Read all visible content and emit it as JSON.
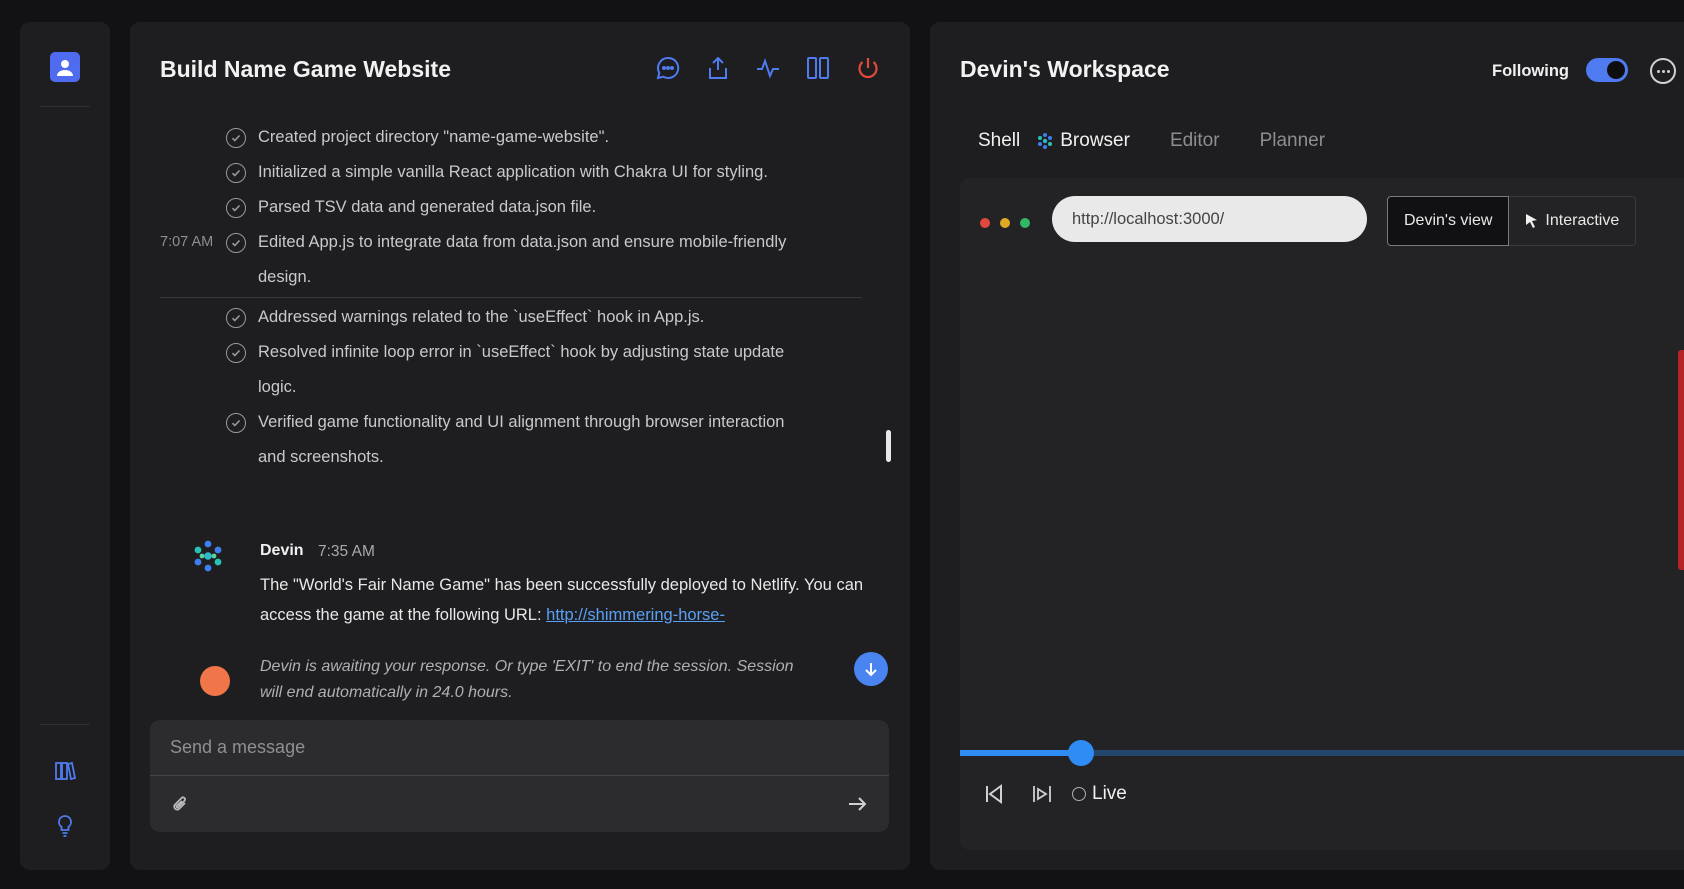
{
  "chat": {
    "title": "Build Name Game Website",
    "tools": [
      "chat-icon",
      "share-icon",
      "activity-icon",
      "columns-icon",
      "power-icon"
    ],
    "steps_a": [
      {
        "text": "Created project directory \"name-game-website\".",
        "time": ""
      },
      {
        "text": "Initialized a simple vanilla React application with Chakra UI for styling.",
        "time": ""
      },
      {
        "text": "Parsed TSV data and generated data.json file.",
        "time": ""
      },
      {
        "text": "Edited App.js to integrate data from data.json and ensure mobile-friendly design.",
        "time": "7:07 AM"
      }
    ],
    "steps_b": [
      {
        "text": "Addressed warnings related to the `useEffect` hook in App.js."
      },
      {
        "text": "Resolved infinite loop error in `useEffect` hook by adjusting state update logic."
      },
      {
        "text": "Verified game functionality and UI alignment through browser interaction and screenshots."
      }
    ],
    "message": {
      "sender": "Devin",
      "time": "7:35 AM",
      "body": "The \"World's Fair Name Game\" has been successfully deployed to Netlify. You can access the game at the following URL: ",
      "link": "http://shimmering-horse-"
    },
    "awaiting": "Devin is awaiting your response. Or type 'EXIT' to end the session. Session will end automatically in 24.0 hours.",
    "composer_placeholder": "Send a message"
  },
  "workspace": {
    "title": "Devin's Workspace",
    "following_label": "Following",
    "following_on": true,
    "tabs": [
      {
        "label": "Shell",
        "active": true
      },
      {
        "label": "Browser",
        "active": true
      },
      {
        "label": "Editor",
        "active": false
      },
      {
        "label": "Planner",
        "active": false
      }
    ],
    "browser": {
      "url": "http://localhost:3000/",
      "view_on": "Devin's view",
      "view_off": "Interactive"
    },
    "timeline_progress": 0.167,
    "live_label": "Live"
  },
  "colors": {
    "accent": "#2f8cf5",
    "toggle": "#4f7bf0",
    "avatar": "#4f6cf0",
    "user_dot": "#f0764a",
    "power": "#e2493c",
    "link": "#5aa0f5"
  }
}
